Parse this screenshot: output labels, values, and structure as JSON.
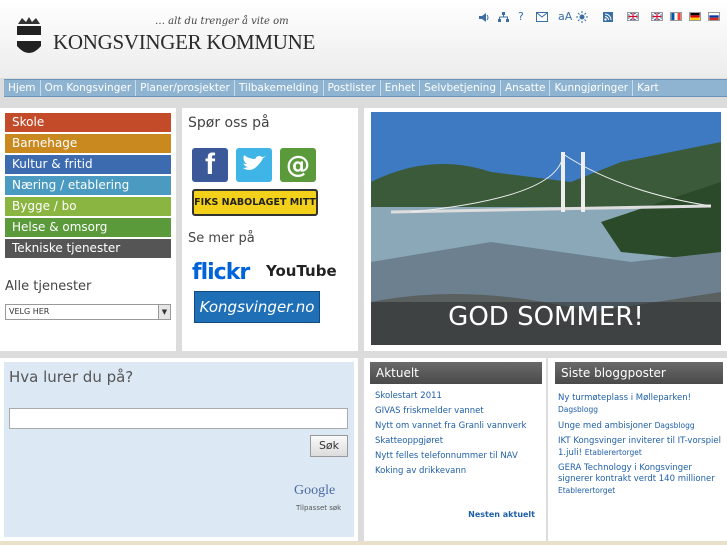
{
  "header": {
    "tagline": "… alt du trenger å vite om",
    "site_name": "KONGSVINGER KOMMUNE"
  },
  "utility_icons": [
    "speaker-icon",
    "sitemap-icon",
    "help-icon",
    "mail-icon",
    "text-size-icon",
    "contrast-icon",
    "rss-icon"
  ],
  "utility": {
    "help": "?",
    "text_size": "aA"
  },
  "nav": {
    "items": [
      "Hjem",
      "Om Kongsvinger",
      "Planer/prosjekter",
      "Tilbakemelding",
      "Postlister",
      "Enhet",
      "Selvbetjening",
      "Ansatte",
      "Kunngjøringer",
      "Kart"
    ]
  },
  "categories": [
    {
      "label": "Skole",
      "color": "#c44b2a"
    },
    {
      "label": "Barnehage",
      "color": "#c9891f"
    },
    {
      "label": "Kultur & fritid",
      "color": "#3d6bb0"
    },
    {
      "label": "Næring / etablering",
      "color": "#4a9ac2"
    },
    {
      "label": "Bygge / bo",
      "color": "#8ab540"
    },
    {
      "label": "Helse & omsorg",
      "color": "#5a9a3a"
    },
    {
      "label": "Tekniske tjenester",
      "color": "#555555"
    }
  ],
  "services": {
    "title": "Alle tjenester",
    "select": "VELG HER"
  },
  "social": {
    "ask_title": "Spør oss på",
    "fiks": "FIKS NABOLAGET MITT",
    "see_title": "Se mer på",
    "flickr": "flickr",
    "youtube": "YouTube",
    "kongsvinger": "Kongsvinger.no"
  },
  "hero": {
    "caption": "GOD SOMMER!"
  },
  "search": {
    "title": "Hva lurer du på?",
    "input_value": "",
    "button": "Søk",
    "google": "Google",
    "google_sub": "Tilpasset søk"
  },
  "news": {
    "title": "Aktuelt",
    "items": [
      "Skolestart 2011",
      "GIVAS friskmelder vannet",
      "Nytt om vannet fra Granli vannverk",
      "Skatteoppgjøret",
      "Nytt felles telefonnummer til NAV",
      "Koking av drikkevann"
    ],
    "more": "Nesten aktuelt"
  },
  "blog": {
    "title": "Siste bloggposter",
    "items": [
      {
        "text": "Ny turmøteplass i Mølleparken!",
        "source": "Dagsblogg"
      },
      {
        "text": "Unge med ambisjoner",
        "source": "Dagsblogg"
      },
      {
        "text": "IKT Kongsvinger inviterer til IT-vorspiel 1.juli!",
        "source": "Etablerertorget"
      },
      {
        "text": "GERA Technology i Kongsvinger signerer kontrakt verdt 140 millioner",
        "source": "Etablerertorget"
      }
    ]
  }
}
